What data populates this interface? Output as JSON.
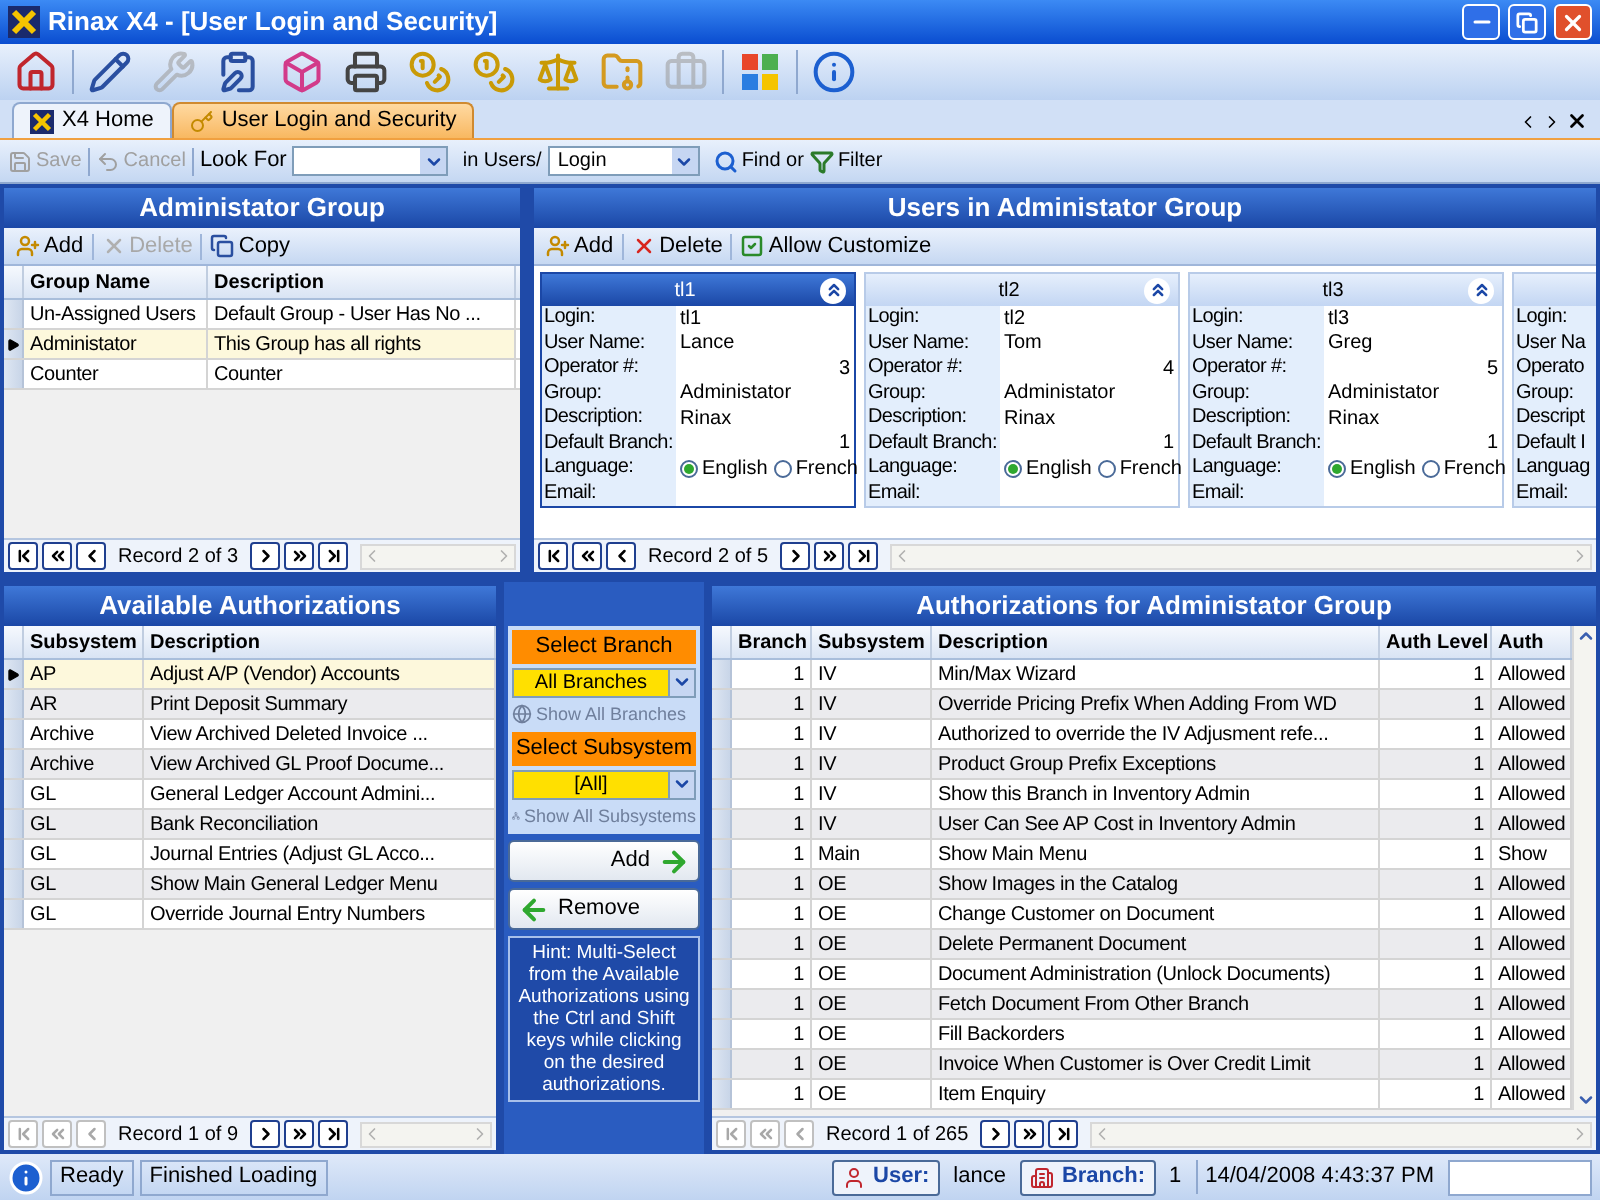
{
  "window": {
    "title": "Rinax X4 - [User Login and Security]"
  },
  "toolbar": [
    {
      "kind": "home",
      "disabled": false
    },
    {
      "kind": "edit",
      "disabled": false
    },
    {
      "kind": "tools",
      "disabled": true
    },
    {
      "kind": "form",
      "disabled": false
    },
    {
      "kind": "cube",
      "disabled": false
    },
    {
      "kind": "print",
      "disabled": false
    },
    {
      "kind": "coins",
      "disabled": false
    },
    {
      "kind": "coins",
      "disabled": false
    },
    {
      "kind": "balance",
      "disabled": false
    },
    {
      "kind": "cabinet",
      "disabled": false
    },
    {
      "kind": "toolbox",
      "disabled": true
    },
    {
      "kind": "windows",
      "disabled": false
    },
    {
      "kind": "info",
      "disabled": false
    }
  ],
  "tabs": [
    {
      "label": "X4 Home",
      "selected": false,
      "kind": "logo"
    },
    {
      "label": "User Login and Security",
      "selected": true,
      "kind": "key"
    }
  ],
  "command_bar": {
    "save": {
      "label": "Save",
      "disabled": true
    },
    "cancel": {
      "label": "Cancel",
      "disabled": true
    },
    "look_for_label": "Look For",
    "in_label": "in Users/",
    "field_combo": {
      "value": "Login"
    },
    "find": "Find or",
    "filter": "Filter"
  },
  "admin_group": {
    "title": "Administator Group",
    "toolbar": [
      {
        "kind": "add",
        "label": "Add",
        "disabled": false
      },
      {
        "kind": "delete",
        "label": "Delete",
        "disabled": true
      },
      {
        "kind": "copy",
        "label": "Copy",
        "disabled": false
      }
    ],
    "columns": [
      {
        "label": "Group Name"
      },
      {
        "label": "Description"
      }
    ],
    "rows": [
      {
        "cells": [
          "Un-Assigned Users",
          "Default Group - User Has No ..."
        ],
        "selected": false
      },
      {
        "cells": [
          "Administator",
          "This Group has all rights"
        ],
        "selected": true
      },
      {
        "cells": [
          "Counter",
          "Counter"
        ],
        "selected": false
      }
    ],
    "record": "Record 2 of 3",
    "nav_start_disabled": false
  },
  "users": {
    "title": "Users in Administator Group",
    "toolbar": [
      {
        "kind": "add",
        "label": "Add",
        "disabled": false
      },
      {
        "kind": "delete",
        "label": "Delete",
        "disabled": false
      },
      {
        "kind": "customize",
        "label": "Allow Customize",
        "disabled": false
      }
    ],
    "cards": [
      {
        "title": "tl1",
        "selected": true,
        "fields": [
          {
            "kind": "text",
            "label": "Login:",
            "value": "tl1"
          },
          {
            "kind": "text",
            "label": "User Name:",
            "value": "Lance"
          },
          {
            "kind": "number",
            "label": "Operator #:",
            "value": "3"
          },
          {
            "kind": "text",
            "label": "Group:",
            "value": "Administator"
          },
          {
            "kind": "text",
            "label": "Description:",
            "value": "Rinax"
          },
          {
            "kind": "number",
            "label": "Default Branch:",
            "value": "1"
          },
          {
            "kind": "radio",
            "label": "Language:",
            "options": [
              {
                "label": "English",
                "selected": true
              },
              {
                "label": "French",
                "selected": false
              }
            ]
          },
          {
            "kind": "text",
            "label": "Email:"
          }
        ]
      },
      {
        "title": "tl2",
        "selected": false,
        "fields": [
          {
            "kind": "text",
            "label": "Login:",
            "value": "tl2"
          },
          {
            "kind": "text",
            "label": "User Name:",
            "value": "Tom"
          },
          {
            "kind": "number",
            "label": "Operator #:",
            "value": "4"
          },
          {
            "kind": "text",
            "label": "Group:",
            "value": "Administator"
          },
          {
            "kind": "text",
            "label": "Description:",
            "value": "Rinax"
          },
          {
            "kind": "number",
            "label": "Default Branch:",
            "value": "1"
          },
          {
            "kind": "radio",
            "label": "Language:",
            "options": [
              {
                "label": "English",
                "selected": true
              },
              {
                "label": "French",
                "selected": false
              }
            ]
          },
          {
            "kind": "text",
            "label": "Email:"
          }
        ]
      },
      {
        "title": "tl3",
        "selected": false,
        "fields": [
          {
            "kind": "text",
            "label": "Login:",
            "value": "tl3"
          },
          {
            "kind": "text",
            "label": "User Name:",
            "value": "Greg"
          },
          {
            "kind": "number",
            "label": "Operator #:",
            "value": "5"
          },
          {
            "kind": "text",
            "label": "Group:",
            "value": "Administator"
          },
          {
            "kind": "text",
            "label": "Description:",
            "value": "Rinax"
          },
          {
            "kind": "number",
            "label": "Default Branch:",
            "value": "1"
          },
          {
            "kind": "radio",
            "label": "Language:",
            "options": [
              {
                "label": "English",
                "selected": true
              },
              {
                "label": "French",
                "selected": false
              }
            ]
          },
          {
            "kind": "text",
            "label": "Email:"
          }
        ]
      },
      {
        "selected": false,
        "fields": [
          {
            "label": "Login:"
          },
          {
            "label": "User Na"
          },
          {
            "label": "Operato"
          },
          {
            "label": "Group:"
          },
          {
            "label": "Descript"
          },
          {
            "label": "Default I"
          },
          {
            "label": "Languag"
          },
          {
            "label": "Email:"
          }
        ]
      }
    ],
    "record": "Record 2 of 5",
    "nav_start_disabled": false
  },
  "available": {
    "title": "Available Authorizations",
    "columns": [
      {
        "label": "Subsystem"
      },
      {
        "label": "Description"
      }
    ],
    "rows": [
      {
        "cells": [
          "AP",
          "Adjust A/P (Vendor) Accounts"
        ],
        "selected": true
      },
      {
        "cells": [
          "AR",
          "Print Deposit Summary"
        ],
        "selected": false
      },
      {
        "cells": [
          "Archive",
          "View Archived Deleted Invoice ..."
        ],
        "selected": false
      },
      {
        "cells": [
          "Archive",
          "View Archived GL Proof Docume..."
        ],
        "selected": false
      },
      {
        "cells": [
          "GL",
          "General Ledger Account Admini..."
        ],
        "selected": false
      },
      {
        "cells": [
          "GL",
          "Bank Reconciliation"
        ],
        "selected": false
      },
      {
        "cells": [
          "GL",
          "Journal Entries (Adjust GL Acco..."
        ],
        "selected": false
      },
      {
        "cells": [
          "GL",
          "Show Main General Ledger Menu"
        ],
        "selected": false
      },
      {
        "cells": [
          "GL",
          "Override Journal Entry Numbers"
        ],
        "selected": false
      }
    ],
    "record": "Record 1 of 9",
    "nav_start_disabled": true
  },
  "filters": {
    "branch_label": "Select Branch",
    "branch_value": "All Branches",
    "show_branches": {
      "label": "Show All Branches",
      "disabled": true
    },
    "subsystem_label": "Select Subsystem",
    "subsystem_value": "[All]",
    "show_subsystems": {
      "label": "Show All Subsystems",
      "disabled": true
    },
    "add": "Add",
    "remove": "Remove",
    "hint": "Hint: Multi-Select from the Available Authorizations using the Ctrl and Shift keys while clicking on the desired authorizations."
  },
  "authorizations": {
    "title": "Authorizations for Administator Group",
    "columns": [
      {
        "label": "Branch",
        "kind": "number"
      },
      {
        "label": "Subsystem",
        "kind": "text"
      },
      {
        "label": "Description",
        "kind": "text"
      },
      {
        "label": "Auth Level",
        "kind": "number"
      },
      {
        "label": "Auth",
        "kind": "text"
      }
    ],
    "rows": [
      {
        "cells": [
          "1",
          "IV",
          "Min/Max Wizard",
          "1",
          "Allowed"
        ],
        "selected": false
      },
      {
        "cells": [
          "1",
          "IV",
          "Override Pricing Prefix When Adding From WD",
          "1",
          "Allowed"
        ],
        "selected": false
      },
      {
        "cells": [
          "1",
          "IV",
          "Authorized to override the IV Adjusment refe...",
          "1",
          "Allowed"
        ],
        "selected": false
      },
      {
        "cells": [
          "1",
          "IV",
          "Product Group Prefix Exceptions",
          "1",
          "Allowed"
        ],
        "selected": false
      },
      {
        "cells": [
          "1",
          "IV",
          "Show this Branch in Inventory Admin",
          "1",
          "Allowed"
        ],
        "selected": false
      },
      {
        "cells": [
          "1",
          "IV",
          "User Can See AP Cost in Inventory Admin",
          "1",
          "Allowed"
        ],
        "selected": false
      },
      {
        "cells": [
          "1",
          "Main",
          "Show Main Menu",
          "1",
          "Show"
        ],
        "selected": false
      },
      {
        "cells": [
          "1",
          "OE",
          "Show Images in the Catalog",
          "1",
          "Allowed"
        ],
        "selected": false
      },
      {
        "cells": [
          "1",
          "OE",
          "Change Customer on Document",
          "1",
          "Allowed"
        ],
        "selected": false
      },
      {
        "cells": [
          "1",
          "OE",
          "Delete Permanent Document",
          "1",
          "Allowed"
        ],
        "selected": false
      },
      {
        "cells": [
          "1",
          "OE",
          "Document Administration (Unlock Documents)",
          "1",
          "Allowed"
        ],
        "selected": false
      },
      {
        "cells": [
          "1",
          "OE",
          "Fetch Document From Other Branch",
          "1",
          "Allowed"
        ],
        "selected": false
      },
      {
        "cells": [
          "1",
          "OE",
          "Fill Backorders",
          "1",
          "Allowed"
        ],
        "selected": false
      },
      {
        "cells": [
          "1",
          "OE",
          "Invoice When Customer is Over Credit Limit",
          "1",
          "Allowed"
        ],
        "selected": false
      },
      {
        "cells": [
          "1",
          "OE",
          "Item Enquiry",
          "1",
          "Allowed"
        ],
        "selected": false
      }
    ],
    "record": "Record 1 of 265",
    "nav_start_disabled": true
  },
  "status_bar": {
    "ready": "Ready",
    "message": "Finished Loading",
    "user_label": "User:",
    "user": "lance",
    "branch_label": "Branch:",
    "branch": "1",
    "datetime": "14/04/2008 4:43:37 PM"
  }
}
